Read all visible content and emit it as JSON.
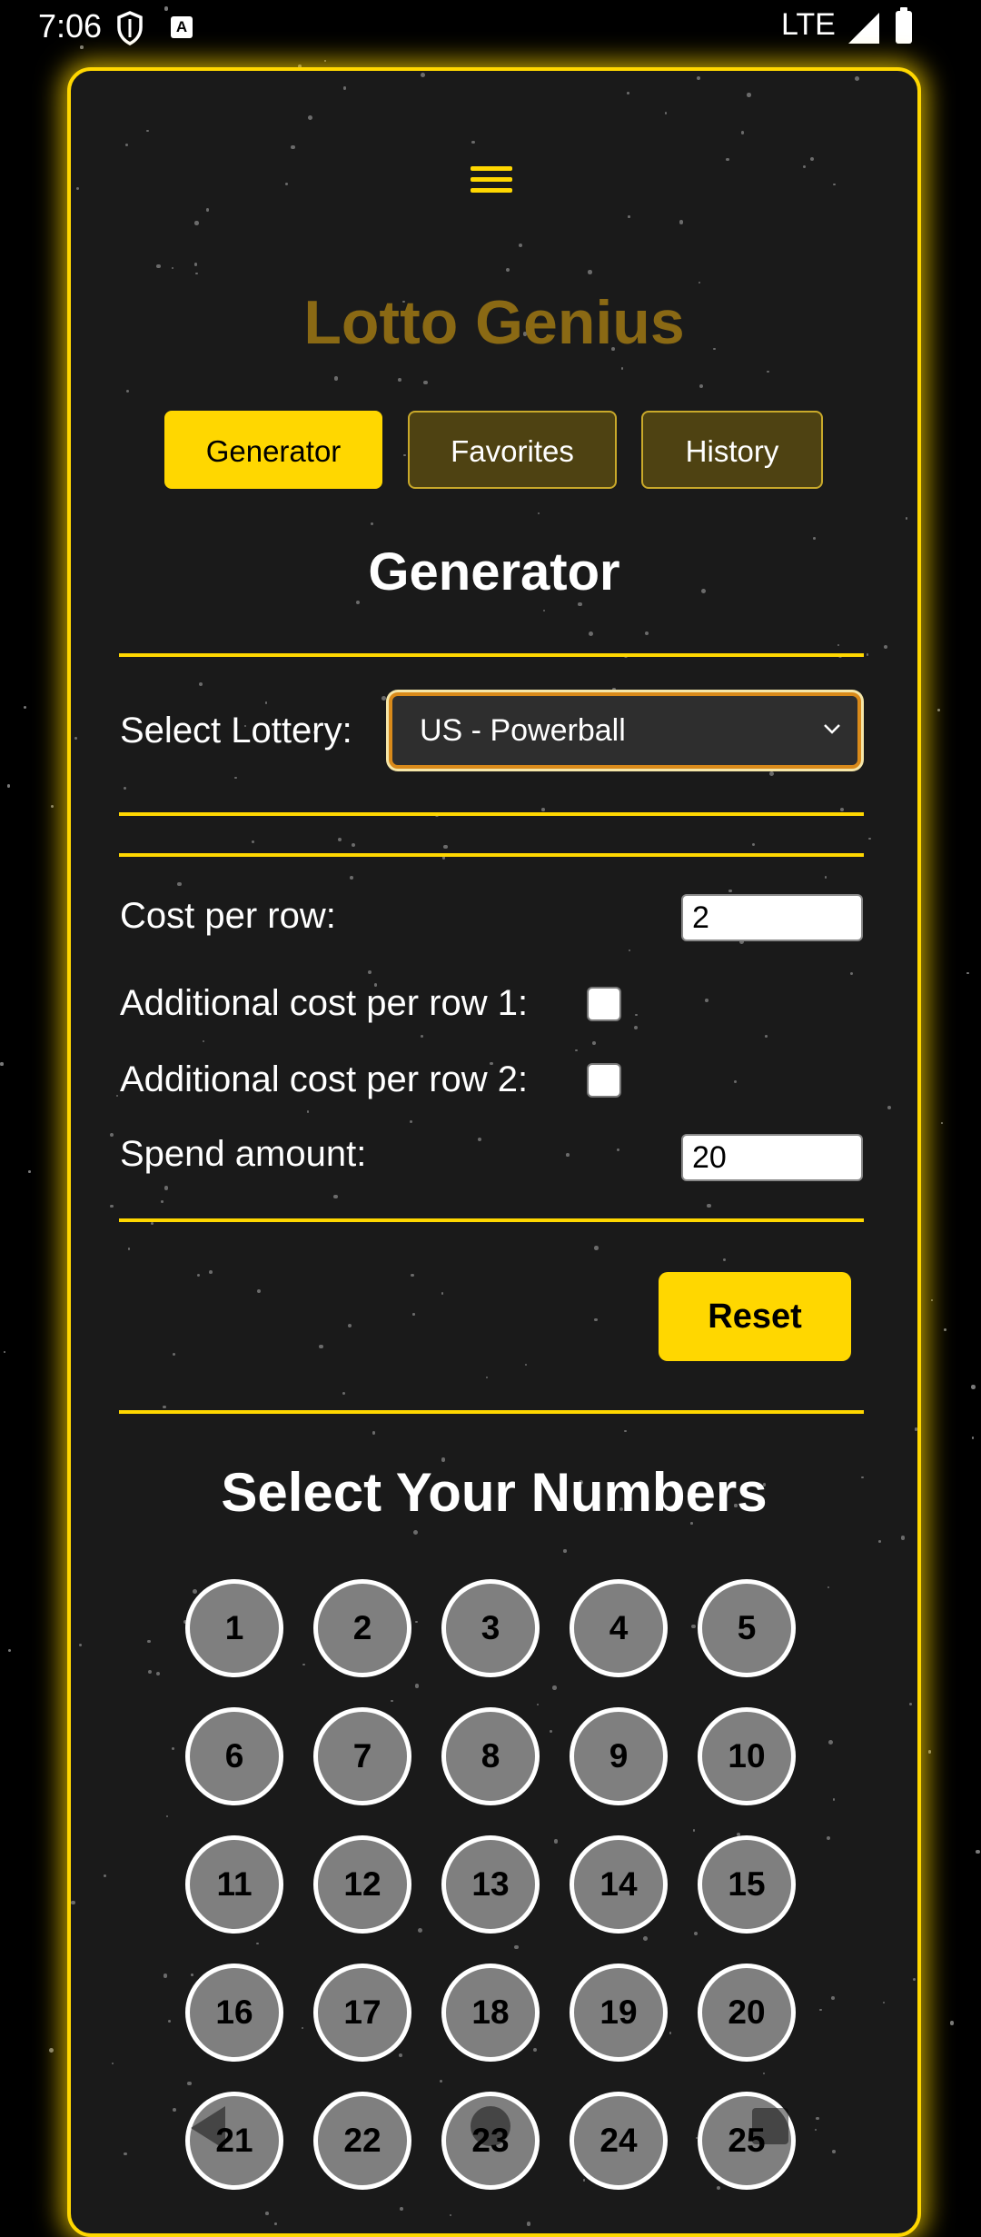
{
  "status_bar": {
    "time": "7:06",
    "network": "LTE",
    "icons": [
      "shield-icon",
      "font-a-icon",
      "signal-icon",
      "battery-icon"
    ]
  },
  "app": {
    "title": "Lotto Genius",
    "menu_icon": "hamburger-menu-icon",
    "accent_color": "#ffd700",
    "title_color": "#8a6914",
    "background_color": "#1a1a1a"
  },
  "tabs": [
    {
      "label": "Generator",
      "active": true
    },
    {
      "label": "Favorites",
      "active": false
    },
    {
      "label": "History",
      "active": false
    }
  ],
  "generator": {
    "section_title": "Generator",
    "select_lottery_label": "Select Lottery:",
    "selected_lottery": "US - Powerball",
    "cost_per_row_label": "Cost per row:",
    "cost_per_row_value": "2",
    "additional_cost_1_label": "Additional cost per row 1:",
    "additional_cost_1_checked": false,
    "additional_cost_2_label": "Additional cost per row 2:",
    "additional_cost_2_checked": false,
    "spend_amount_label": "Spend amount:",
    "spend_amount_value": "20",
    "reset_label": "Reset"
  },
  "numbers": {
    "section_title": "Select Your Numbers",
    "balls": [
      "1",
      "2",
      "3",
      "4",
      "5",
      "6",
      "7",
      "8",
      "9",
      "10",
      "11",
      "12",
      "13",
      "14",
      "15",
      "16",
      "17",
      "18",
      "19",
      "20",
      "21",
      "22",
      "23",
      "24",
      "25"
    ]
  },
  "nav_bar": {
    "icons": [
      "back-icon",
      "home-icon",
      "recents-icon"
    ]
  }
}
